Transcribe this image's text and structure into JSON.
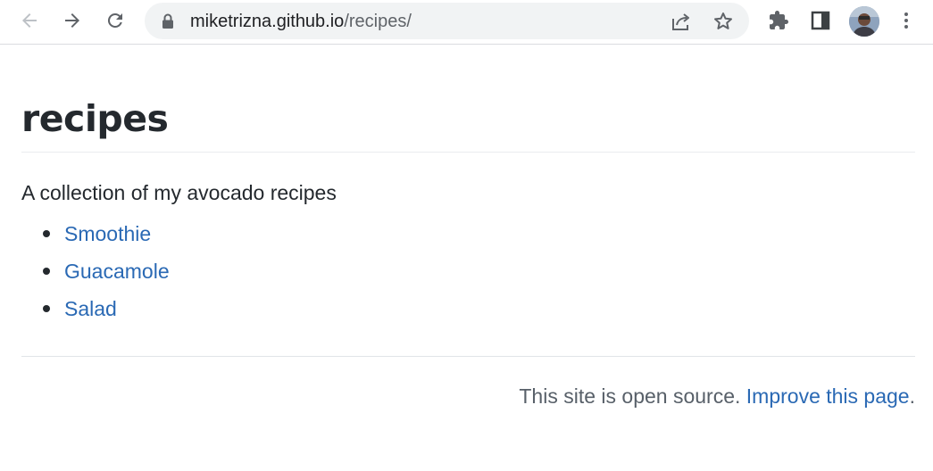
{
  "browser": {
    "url_host": "miketrizna.github.io",
    "url_path": "/recipes/",
    "icons": {
      "back": "back-arrow-icon",
      "forward": "forward-arrow-icon",
      "reload": "reload-icon",
      "lock": "lock-icon",
      "share": "share-icon",
      "bookmark": "star-icon",
      "extensions": "puzzle-icon",
      "side_panel": "side-panel-icon",
      "menu": "kebab-menu-icon"
    }
  },
  "page": {
    "title": "recipes",
    "description": "A collection of my avocado recipes",
    "recipes": [
      {
        "label": "Smoothie"
      },
      {
        "label": "Guacamole"
      },
      {
        "label": "Salad"
      }
    ],
    "footer": {
      "text": "This site is open source.",
      "link_label": "Improve this page",
      "trailing": "."
    }
  },
  "colors": {
    "link": "#2a69b4",
    "text": "#24292e",
    "muted": "#586069"
  }
}
